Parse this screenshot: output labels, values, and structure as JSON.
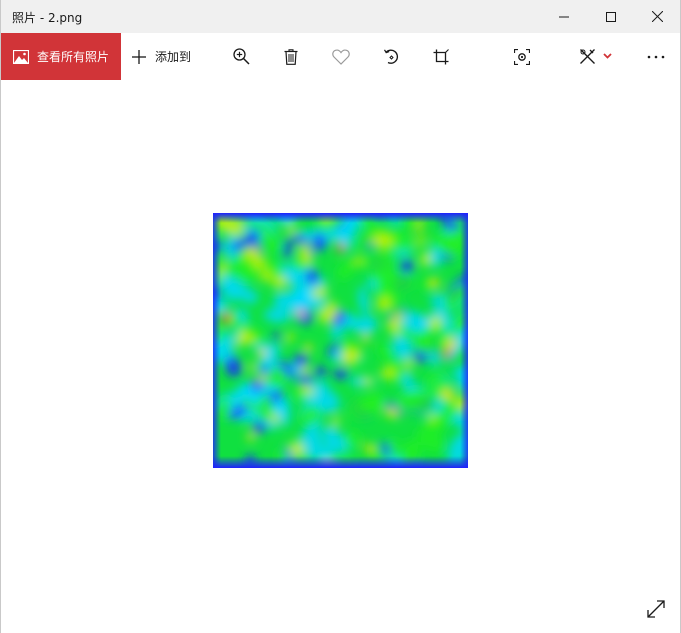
{
  "window": {
    "title": "照片 - 2.png",
    "minimize_icon": "minimize-icon",
    "maximize_icon": "maximize-icon",
    "close_icon": "close-icon"
  },
  "toolbar": {
    "view_all_label": "查看所有照片",
    "view_all_icon": "photos-icon",
    "add_to_label": "添加到",
    "add_to_icon": "plus-icon",
    "tools": [
      "zoom-in-icon",
      "delete-icon",
      "favorite-icon",
      "rotate-icon",
      "crop-icon",
      "enhance-icon",
      "edit-draw-icon",
      "more-icon"
    ],
    "accent_color": "#d13438"
  },
  "photo": {
    "file_name": "2.png",
    "content": "heatmap-noise-image"
  }
}
